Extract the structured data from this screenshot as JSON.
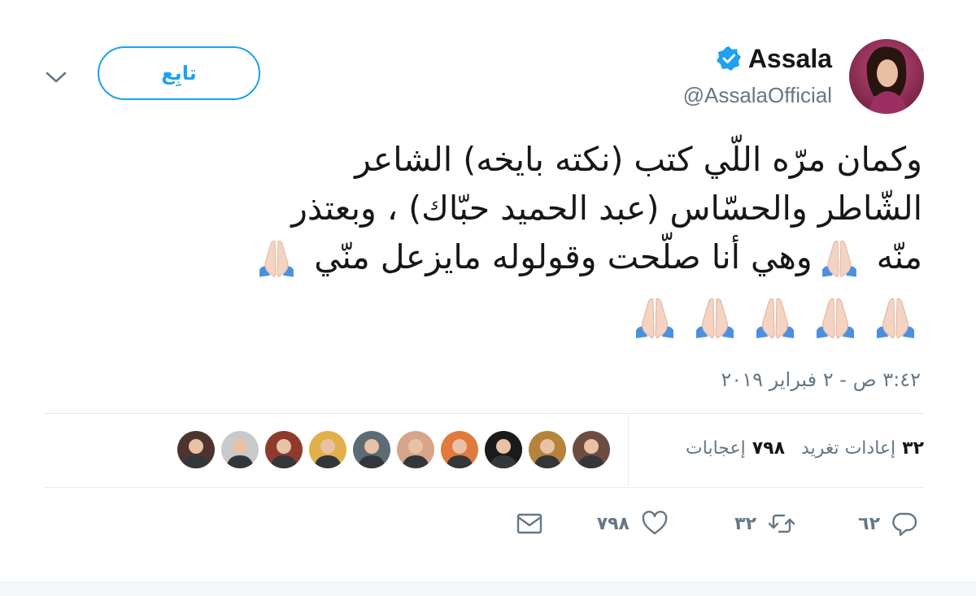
{
  "author": {
    "display_name": "Assala",
    "handle": "@AssalaOfficial",
    "verified": true
  },
  "follow_button": {
    "label": "تابِع"
  },
  "tweet": {
    "lines": [
      "وكمان مرّه اللّي كتب (نكته بايخه) الشاعر",
      "الشّاطر والحسّاس (عبد الحميد حبّاك) ، وبعتذر",
      "منّه ",
      "وهي أنا صلّحت وقولوله مايزعل منّي "
    ],
    "emoji": "folded-hands",
    "trailing_emoji_count": 5
  },
  "timestamp": "٣:٤٢ ص - ٢ فبراير ٢٠١٩",
  "stats": {
    "retweets_count": "٣٢",
    "retweets_label": "إعادات تغريد",
    "likes_count": "٧٩٨",
    "likes_label": "إعجابات"
  },
  "likers": [
    "liker-1",
    "liker-2",
    "liker-3",
    "liker-4",
    "liker-5",
    "liker-6",
    "liker-7",
    "liker-8",
    "liker-9",
    "liker-10"
  ],
  "actions": {
    "reply_count": "٦٢",
    "retweet_count": "٣٢",
    "like_count": "٧٩٨"
  },
  "colors": {
    "accent": "#1da1f2",
    "text": "#14171a",
    "muted": "#657786",
    "divider": "#e6ecf0"
  }
}
